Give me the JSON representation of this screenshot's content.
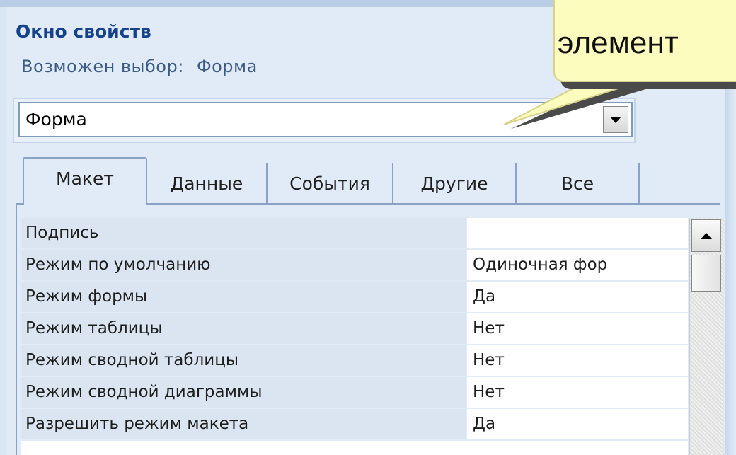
{
  "property_sheet": {
    "title": "Окно свойств",
    "selection_label": "Возможен выбор:",
    "selection_value": "Форма",
    "object_combo_value": "Форма"
  },
  "tabs": [
    {
      "label": "Макет",
      "active": true
    },
    {
      "label": "Данные",
      "active": false
    },
    {
      "label": "События",
      "active": false
    },
    {
      "label": "Другие",
      "active": false
    },
    {
      "label": "Все",
      "active": false
    }
  ],
  "properties": [
    {
      "name": "Подпись",
      "value": ""
    },
    {
      "name": "Режим по умолчанию",
      "value": "Одиночная фор"
    },
    {
      "name": "Режим формы",
      "value": "Да"
    },
    {
      "name": "Режим таблицы",
      "value": "Нет"
    },
    {
      "name": "Режим сводной таблицы",
      "value": "Нет"
    },
    {
      "name": "Режим сводной диаграммы",
      "value": "Нет"
    },
    {
      "name": "Разрешить режим макета",
      "value": "Да"
    }
  ],
  "callout": {
    "text": "элемент"
  },
  "colors": {
    "title": "#15428b",
    "panel": "#e1ebf7",
    "property_name_bg": "#dbe5f2",
    "callout_bg": "#fdfcbf"
  }
}
